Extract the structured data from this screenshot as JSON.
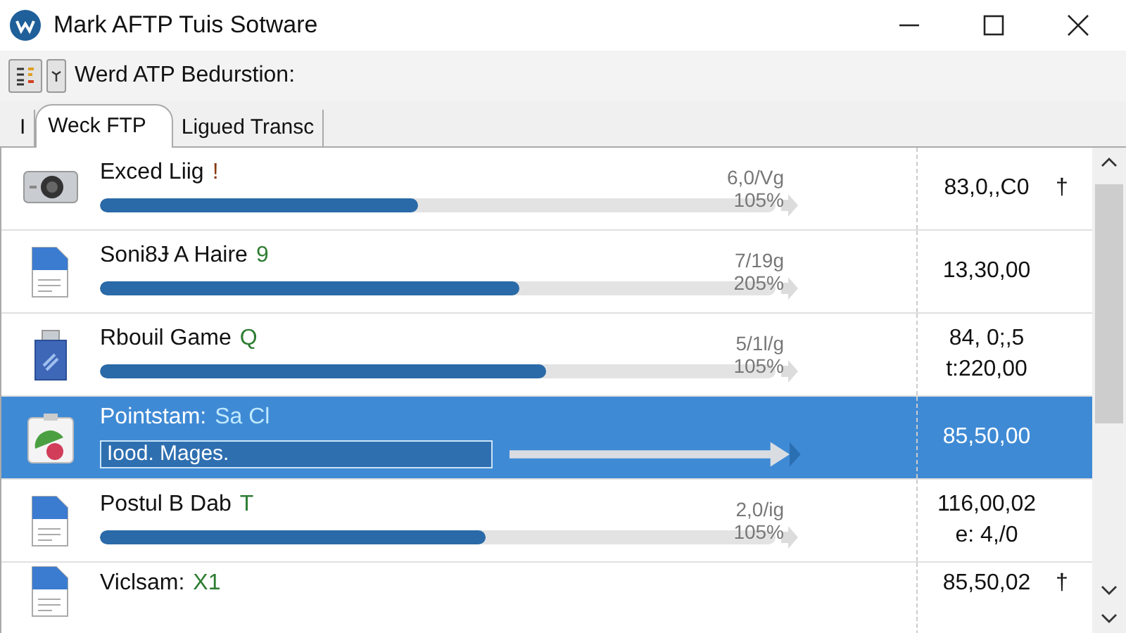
{
  "window": {
    "title": "Mark AFTP Tuis Sotware"
  },
  "toolbar": {
    "label": "Werd ATP Bedurstion:"
  },
  "tabs": [
    {
      "label": "I",
      "selected": false
    },
    {
      "label": "Weck FTP",
      "selected": true
    },
    {
      "label": "Ligued Transc",
      "selected": false
    }
  ],
  "rows": [
    {
      "kind": "camera",
      "name": "Exced Liig",
      "tag": "!",
      "color": "#8a3a10",
      "level": 0.47,
      "rate": "6,0/Vg",
      "percent": "105%",
      "values": [
        "83,0,,C0"
      ],
      "pin": "†",
      "selected": false
    },
    {
      "kind": "document",
      "name": "Soni8Ɉ A Haire",
      "tag": "9",
      "color": "#2e7d32",
      "level": 0.62,
      "rate": "7/19g",
      "percent": "205%",
      "values": [
        "13,30,00"
      ],
      "selected": false
    },
    {
      "kind": "usb",
      "name": "Rbouil Game",
      "tag": "Q",
      "color": "#2e7d32",
      "level": 0.66,
      "rate": "5/1l/g",
      "percent": "105%",
      "values": [
        "84, 0;,5",
        "t:220,00"
      ],
      "selected": false
    },
    {
      "kind": "chart",
      "name": "Pointstam:",
      "tag": "Sa Cl",
      "color": "#bfe9ff",
      "field_value": "Iood. Mages.",
      "values": [
        "85,50,00"
      ],
      "selected": true
    },
    {
      "kind": "document",
      "name": "Postul B Dab",
      "tag": "T",
      "color": "#2e7d32",
      "level": 0.57,
      "rate": "2,0/ig",
      "percent": "105%",
      "values": [
        "116,00,02",
        "e: 4,/0"
      ],
      "selected": false
    },
    {
      "kind": "document",
      "name": "Viclsam:",
      "tag": "X1",
      "color": "#2e7d32",
      "values": [
        "85,50,02"
      ],
      "pin": "†",
      "selected": false
    }
  ]
}
